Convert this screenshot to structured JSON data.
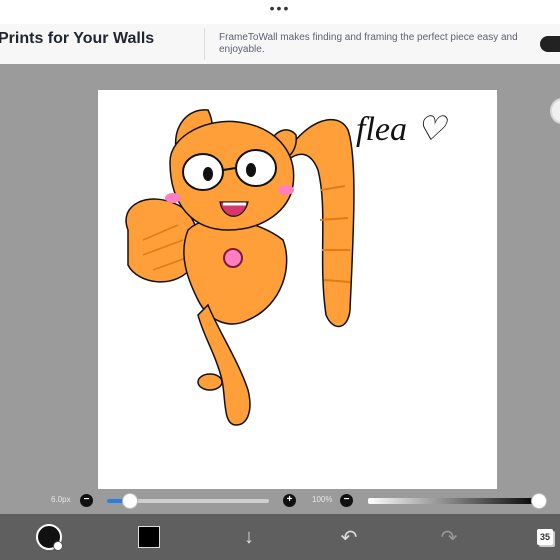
{
  "top_bar": {
    "menu_dots": "•••"
  },
  "ad": {
    "title": "Prints for Your Walls",
    "body": "FrameToWall makes finding and framing the perfect piece easy and enjoyable."
  },
  "canvas": {
    "handwriting": "flea ♡",
    "line_color": "#111111",
    "fill_color": "#ff9f3a",
    "shade_color": "#e07a1a",
    "blush_color": "#ff7fbf"
  },
  "sliders": {
    "brush_size_label": "6.0px",
    "brush_size_fraction": 0.13,
    "opacity_label": "100%",
    "opacity_fraction": 1.0,
    "accent_color": "#2a7de1"
  },
  "toolbar": {
    "brush_icon": "brush-icon",
    "color_icon": "color-swatch-icon",
    "download_icon": "↓",
    "undo_icon": "↶",
    "redo_icon": "↷",
    "layer_count": "35"
  }
}
